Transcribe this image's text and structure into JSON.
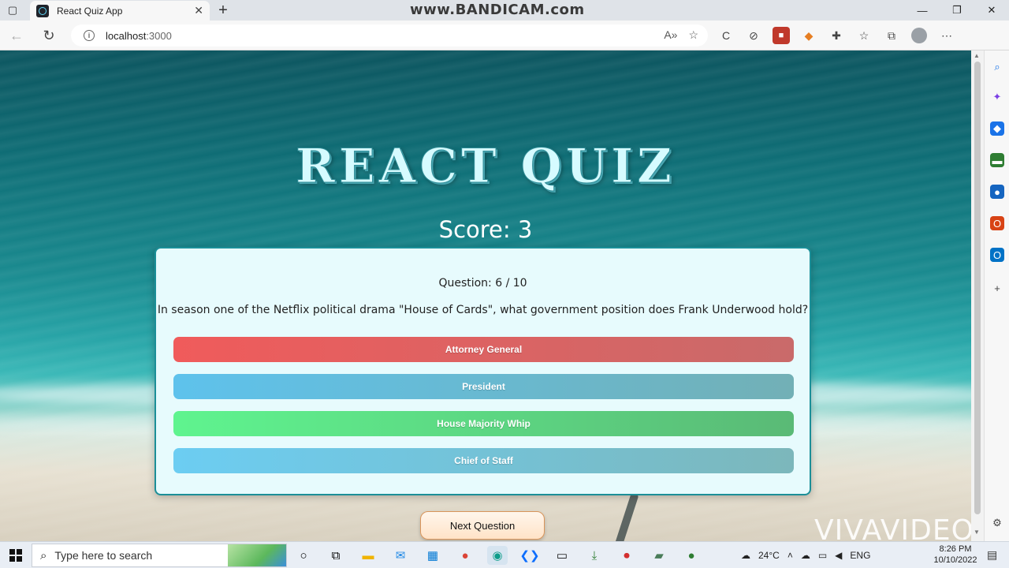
{
  "browser": {
    "tab_title": "React Quiz App",
    "url_host": "localhost",
    "url_port": ":3000"
  },
  "watermarks": {
    "top": "www.BANDICAM.com",
    "bottom": "VIVAVIDEO"
  },
  "quiz": {
    "title": "REACT QUIZ",
    "score_text": "Score: 3",
    "question_number": "Question: 6 / 10",
    "question_text": "In season one of the Netflix political drama \"House of Cards\", what government position does Frank Underwood hold?",
    "answers": [
      {
        "label": "Attorney General",
        "state": "wrong",
        "color_from": "#f05b5b",
        "color_to": "#c96a6a"
      },
      {
        "label": "President",
        "state": "neutral",
        "color_from": "#5ec2ec",
        "color_to": "#72b0b6"
      },
      {
        "label": "House Majority Whip",
        "state": "correct",
        "color_from": "#5ff48f",
        "color_to": "#5aba76"
      },
      {
        "label": "Chief of Staff",
        "state": "neutral",
        "color_from": "#6ccdf2",
        "color_to": "#7cb7bb"
      }
    ],
    "next_button_label": "Next Question"
  },
  "taskbar": {
    "search_placeholder": "Type here to search",
    "weather": "24°C",
    "language": "ENG",
    "time": "8:26 PM",
    "date": "10/10/2022"
  }
}
